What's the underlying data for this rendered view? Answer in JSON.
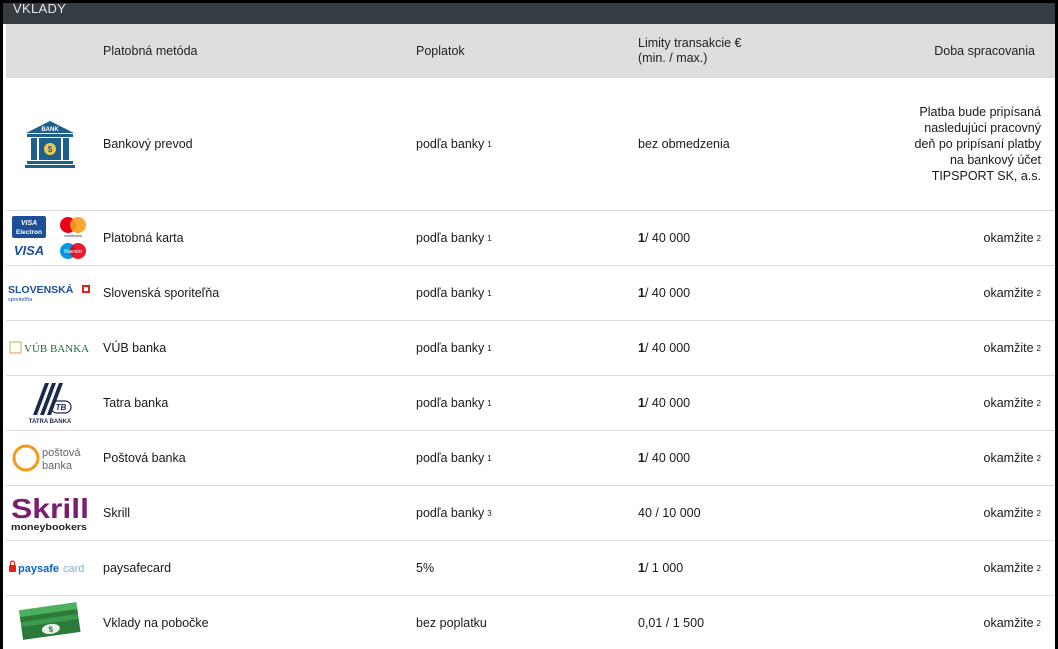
{
  "section_title": "VKLADY",
  "columns": {
    "method": "Platobná metóda",
    "fee": "Poplatok",
    "limits": "Limity transakcie €\n(min. / max.)",
    "processing": "Doba spracovania"
  },
  "rows": [
    {
      "logo": "bank-building-icon",
      "logo_text": "BANK",
      "name": "Bankový prevod",
      "fee": "podľa banky",
      "fee_note": "1",
      "limit_min": "",
      "limit_max": "",
      "limit_text": "bez obmedzenia",
      "time": "Platba bude pripísaná nasledujúci pracovný deň po pripísaní platby na bankový účet TIPSPORT SK, a.s.",
      "time_note": ""
    },
    {
      "logo": "card-brands-logo",
      "logo_text": "VISA Electron mastercard VISA Maestro",
      "name": "Platobná karta",
      "fee": "podľa banky",
      "fee_note": "1",
      "limit_min": "1",
      "limit_max": " / 40 000",
      "limit_text": "",
      "time": "okamžite",
      "time_note": "2"
    },
    {
      "logo": "slovenska-sporitelna-logo",
      "logo_text": "SLOVENSKÁ",
      "logo_subtext": "sporiteľňa",
      "name": "Slovenská sporiteľňa",
      "fee": "podľa banky",
      "fee_note": "1",
      "limit_min": "1",
      "limit_max": " / 40 000",
      "limit_text": "",
      "time": "okamžite",
      "time_note": "2"
    },
    {
      "logo": "vub-banka-logo",
      "logo_text": "VÚB BANKA",
      "name": "VÚB banka",
      "fee": "podľa banky",
      "fee_note": "1",
      "limit_min": "1",
      "limit_max": " / 40 000",
      "limit_text": "",
      "time": "okamžite",
      "time_note": "2"
    },
    {
      "logo": "tatra-banka-logo",
      "logo_text": "TATRA BANKA",
      "logo_subtext": "TB",
      "name": "Tatra banka",
      "fee": "podľa banky",
      "fee_note": "1",
      "limit_min": "1",
      "limit_max": " / 40 000",
      "limit_text": "",
      "time": "okamžite",
      "time_note": "2"
    },
    {
      "logo": "postova-banka-logo",
      "logo_text": "poštová",
      "logo_subtext": "banka",
      "name": "Poštová banka",
      "fee": "podľa banky",
      "fee_note": "1",
      "limit_min": "1",
      "limit_max": " / 40 000",
      "limit_text": "",
      "time": "okamžite",
      "time_note": "2"
    },
    {
      "logo": "skrill-logo",
      "logo_text": "Skrill",
      "logo_subtext": "moneybookers",
      "name": "Skrill",
      "fee": "podľa banky",
      "fee_note": "3",
      "limit_min": "",
      "limit_max": "",
      "limit_text": "40 / 10 000",
      "time": "okamžite",
      "time_note": "2"
    },
    {
      "logo": "paysafecard-logo",
      "logo_text": "paysafe",
      "logo_subtext": "card",
      "name": "paysafecard",
      "fee": "5%",
      "fee_note": "",
      "limit_min": "1",
      "limit_max": " / 1 000",
      "limit_text": "",
      "time": "okamžite",
      "time_note": "2"
    },
    {
      "logo": "cash-money-icon",
      "logo_text": "",
      "name": "Vklady na pobočke",
      "fee": "bez poplatku",
      "fee_note": "",
      "limit_min": "",
      "limit_max": "",
      "limit_text": "0,01 / 1 500",
      "time": "okamžite",
      "time_note": "2"
    }
  ],
  "colors": {
    "title_bar": "#353c42",
    "header_bg": "#dedede",
    "bank_blue": "#1f5f8b",
    "skrill_purple": "#7a1e6e",
    "postova_orange": "#f39a1e",
    "vub_green": "#1f6b3a",
    "sporitelna_blue": "#1c4f9c",
    "paysafe_blue": "#0a63c9",
    "cash_green": "#2c7a3a"
  }
}
